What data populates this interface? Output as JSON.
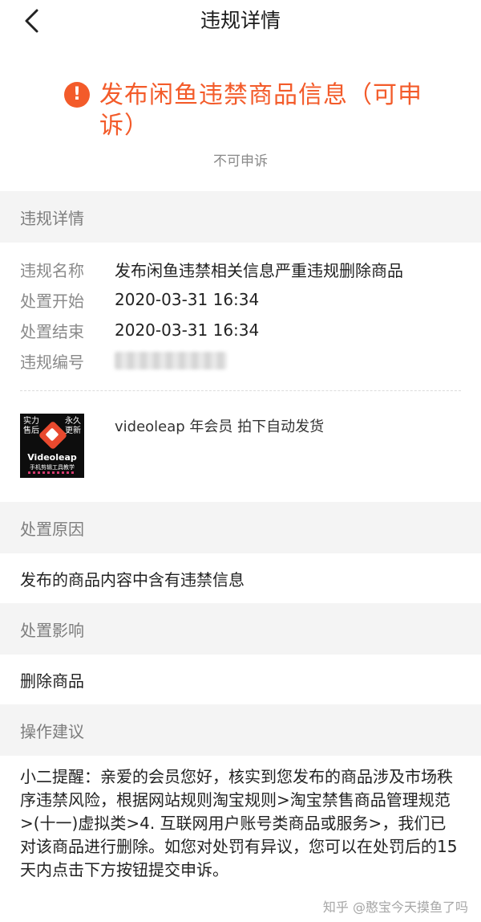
{
  "nav": {
    "title": "违规详情"
  },
  "status": {
    "title": "发布闲鱼违禁商品信息（可申诉）",
    "subtitle": "不可申诉",
    "accent_color": "#f35b2a",
    "icon": "alert-circle-icon"
  },
  "details": {
    "section_title": "违规详情",
    "rows": [
      {
        "label": "违规名称",
        "value": "发布闲鱼违禁相关信息严重违规删除商品"
      },
      {
        "label": "处置开始",
        "value": "2020-03-31 16:34"
      },
      {
        "label": "处置结束",
        "value": "2020-03-31 16:34"
      },
      {
        "label": "违规编号",
        "value": ""
      }
    ]
  },
  "product": {
    "name": "videoleap 年会员 拍下自动发货",
    "thumb_left": "实力售后",
    "thumb_right": "永久更新",
    "thumb_brand": "Videoleap",
    "thumb_tag": "手机剪辑工具教学"
  },
  "reason": {
    "section_title": "处置原因",
    "text": "发布的商品内容中含有违禁信息"
  },
  "impact": {
    "section_title": "处置影响",
    "text": "删除商品"
  },
  "advice": {
    "section_title": "操作建议",
    "text": "小二提醒：亲爱的会员您好，核实到您发布的商品涉及市场秩序违禁风险，根据网站规则淘宝规则>淘宝禁售商品管理规范>(十一)虚拟类>4. 互联网用户账号类商品或服务>，我们已对该商品进行删除。如您对处罚有异议，您可以在处罚后的15天内点击下方按钮提交申诉。"
  },
  "watermark": "知乎 @憨宝今天摸鱼了吗"
}
